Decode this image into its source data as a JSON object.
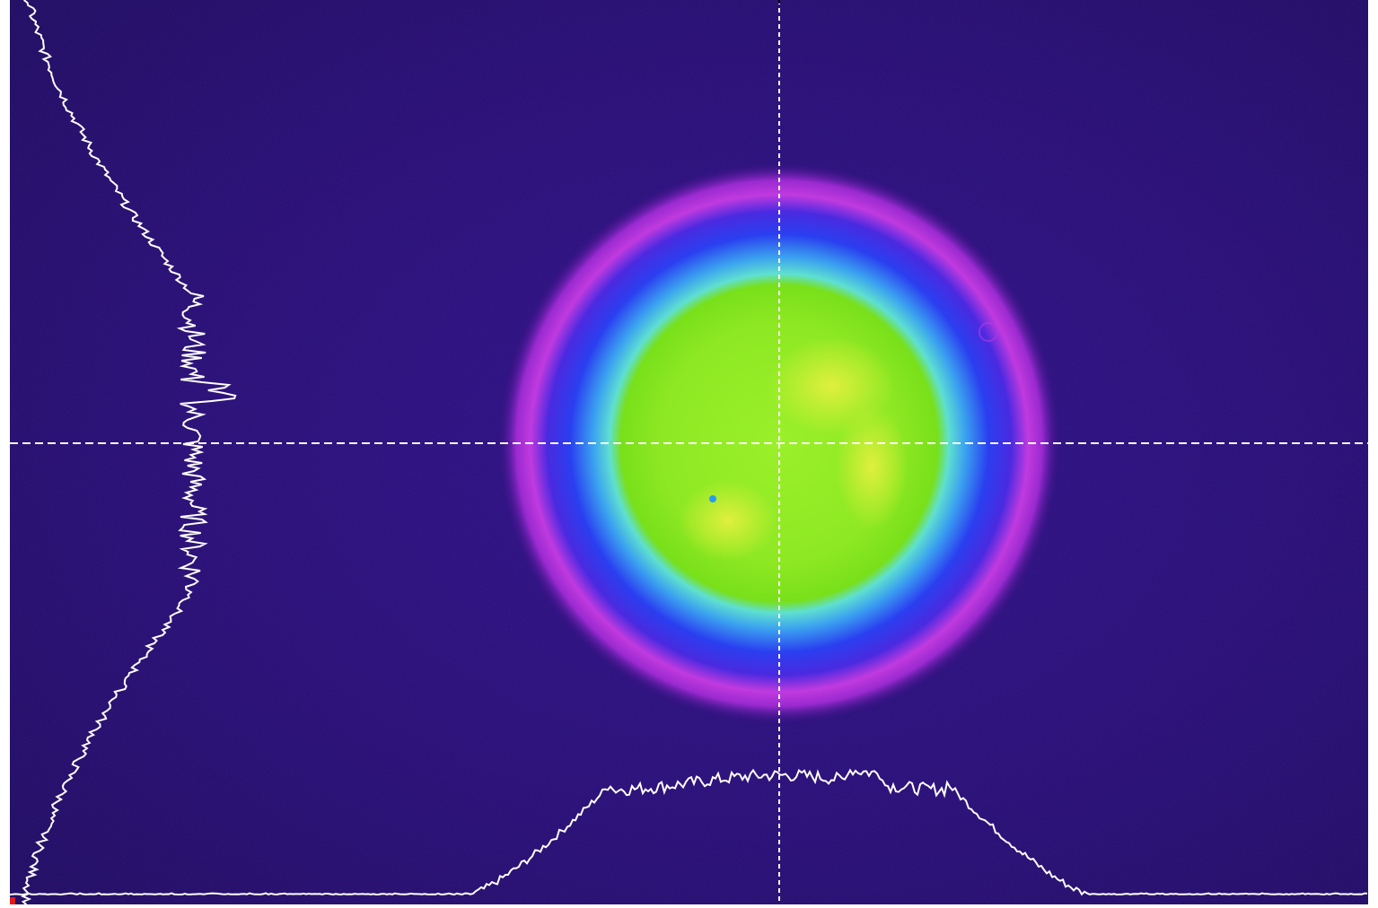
{
  "colors": {
    "background": "#2a0d7a",
    "background_dark": "#1a0a55",
    "halo_magenta": "#d83de0",
    "ring_blue": "#2f3df0",
    "ring_cyan": "#5fe0e0",
    "core_green": "#7fe81a",
    "hotspot_yellow": "#e8f040",
    "profile_line": "#ffffff",
    "crosshair_horizontal": "#ffffff",
    "crosshair_vertical": "#000000",
    "corner_marker": "#e01a1a"
  },
  "crosshair": {
    "style": "dashed",
    "horizontal_color": "white",
    "vertical_color": "black"
  },
  "profiles": {
    "horizontal": {
      "color": "white",
      "baseline": "bottom"
    },
    "vertical": {
      "color": "white",
      "baseline": "left"
    }
  },
  "icons": {
    "corner_marker": "red-square"
  }
}
